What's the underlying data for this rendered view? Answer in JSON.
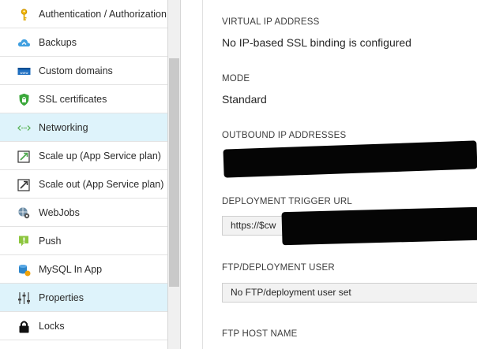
{
  "menu": {
    "items": [
      {
        "label": "Authentication / Authorization",
        "icon": "key-icon",
        "active": false
      },
      {
        "label": "Backups",
        "icon": "cloud-backup-icon",
        "active": false
      },
      {
        "label": "Custom domains",
        "icon": "www-domain-icon",
        "active": false
      },
      {
        "label": "SSL certificates",
        "icon": "shield-lock-icon",
        "active": false
      },
      {
        "label": "Networking",
        "icon": "network-arrows-icon",
        "active": true
      },
      {
        "label": "Scale up (App Service plan)",
        "icon": "scale-up-icon",
        "active": false
      },
      {
        "label": "Scale out (App Service plan)",
        "icon": "scale-out-icon",
        "active": false
      },
      {
        "label": "WebJobs",
        "icon": "webjobs-gear-icon",
        "active": false
      },
      {
        "label": "Push",
        "icon": "push-notification-icon",
        "active": false
      },
      {
        "label": "MySQL In App",
        "icon": "mysql-database-icon",
        "active": false
      },
      {
        "label": "Properties",
        "icon": "properties-sliders-icon",
        "active": true
      },
      {
        "label": "Locks",
        "icon": "lock-icon",
        "active": false
      }
    ]
  },
  "properties": {
    "virtual_ip": {
      "label": "VIRTUAL IP ADDRESS",
      "value": "No IP-based SSL binding is configured"
    },
    "mode": {
      "label": "MODE",
      "value": "Standard"
    },
    "outbound_ip": {
      "label": "OUTBOUND IP ADDRESSES",
      "value": ""
    },
    "deployment_trigger": {
      "label": "DEPLOYMENT TRIGGER URL",
      "value": "https://$cw"
    },
    "ftp_user": {
      "label": "FTP/DEPLOYMENT USER",
      "value": "No FTP/deployment user set"
    },
    "ftp_host": {
      "label": "FTP HOST NAME",
      "value": ""
    }
  },
  "colors": {
    "active_bg": "#def3fb",
    "redaction": "#050505"
  }
}
